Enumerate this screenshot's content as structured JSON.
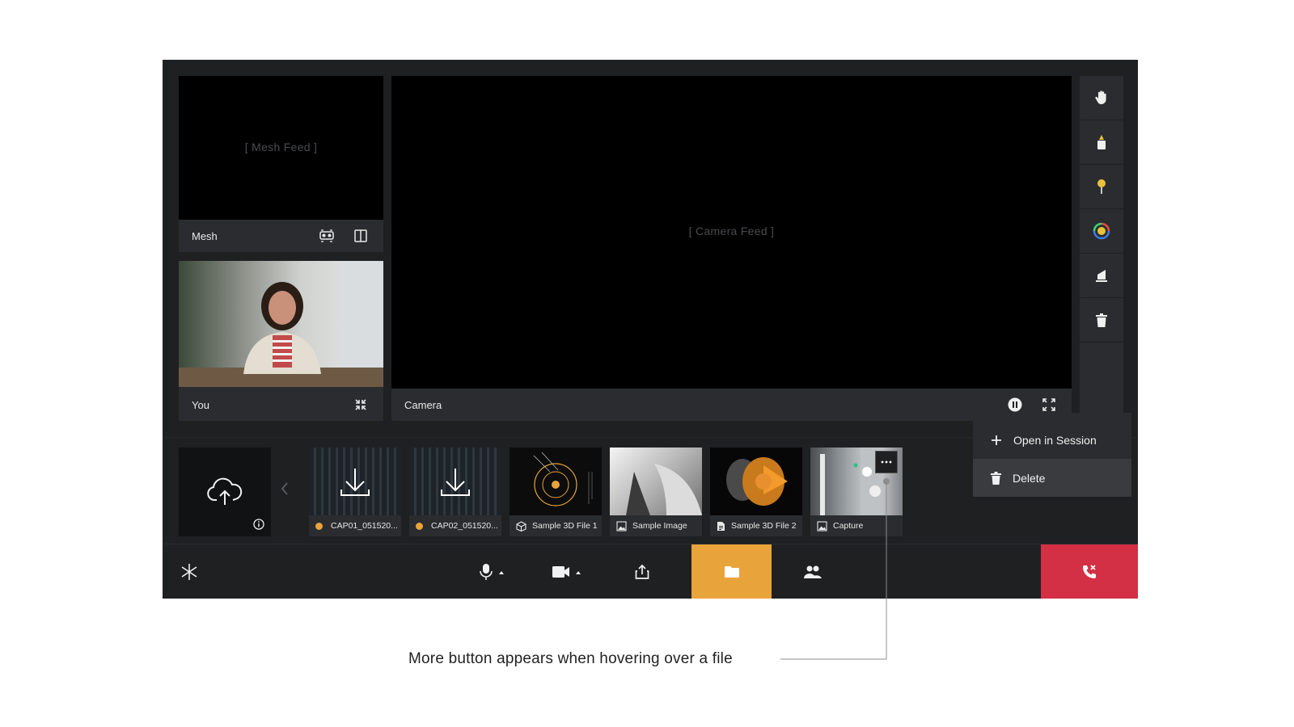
{
  "feeds": {
    "mesh": {
      "placeholder": "[ Mesh Feed ]",
      "label": "Mesh"
    },
    "you": {
      "label": "You"
    },
    "camera": {
      "placeholder": "[ Camera Feed ]",
      "label": "Camera"
    }
  },
  "toolbar": {
    "tools": [
      "hand-icon",
      "highlighter-icon",
      "pin-icon",
      "color-picker-icon",
      "eraser-icon",
      "trash-icon"
    ]
  },
  "files": [
    {
      "name": "CAP01_051520...",
      "kind": "capture",
      "icon": "status-dot"
    },
    {
      "name": "CAP02_051520...",
      "kind": "capture",
      "icon": "status-dot"
    },
    {
      "name": "Sample 3D File 1",
      "kind": "3d",
      "icon": "cube-icon"
    },
    {
      "name": "Sample Image",
      "kind": "image",
      "icon": "image-icon"
    },
    {
      "name": "Sample 3D File 2",
      "kind": "document",
      "icon": "document-icon"
    },
    {
      "name": "Capture",
      "kind": "image",
      "icon": "image-icon"
    }
  ],
  "context_menu": {
    "items": [
      {
        "label": "Open in Session",
        "icon": "plus-icon"
      },
      {
        "label": "Delete",
        "icon": "trash-icon"
      }
    ]
  },
  "bottom_bar": {
    "buttons": [
      "logo-icon",
      "microphone-icon",
      "video-camera-icon",
      "share-screen-icon",
      "folder-icon",
      "participants-icon",
      "end-call-icon"
    ]
  },
  "colors": {
    "accent": "#e8a33b",
    "end_call": "#d32f45",
    "app_bg": "#1f2022",
    "panel": "#2b2c2f"
  },
  "annotation": "More button appears when hovering over a file"
}
